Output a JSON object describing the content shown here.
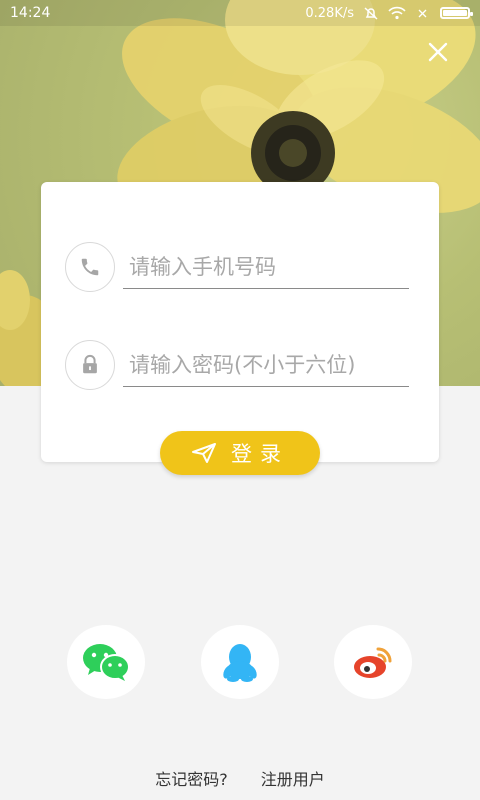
{
  "status_bar": {
    "time": "14:24",
    "net_speed": "0.28K/s"
  },
  "hero": {
    "close_icon": "close-icon"
  },
  "login_form": {
    "phone_placeholder": "请输入手机号码",
    "password_placeholder": "请输入密码(不小于六位)",
    "phone_icon": "phone-icon",
    "lock_icon": "lock-icon",
    "login_button_label": "登录",
    "login_icon": "send-icon",
    "accent_color": "#f0c419"
  },
  "social_login": {
    "items": [
      {
        "name": "wechat",
        "icon": "wechat-icon",
        "color": "#2ecf5a"
      },
      {
        "name": "qq",
        "icon": "qq-icon",
        "color": "#33b5f5"
      },
      {
        "name": "weibo",
        "icon": "weibo-icon",
        "color": "#e6442b"
      }
    ]
  },
  "footer_links": {
    "forgot_password": "忘记密码?",
    "register": "注册用户"
  }
}
